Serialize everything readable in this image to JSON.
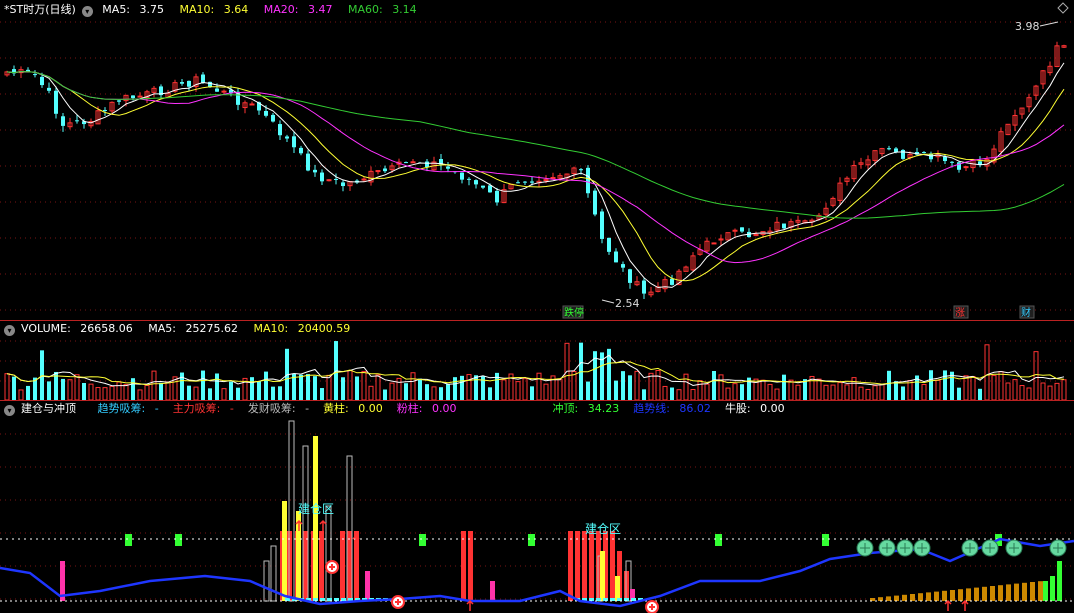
{
  "colors": {
    "ma5": "#ffffff",
    "ma10": "#ffff33",
    "ma20": "#ff33ff",
    "ma60": "#33cc33",
    "up": "#ff3333",
    "down": "#54ffff",
    "volume_up": "#ff3333",
    "volume_down": "#54ffff",
    "trend_line": "#1e36ff",
    "grid": "#7a1515"
  },
  "price_panel": {
    "title": "*ST时万(日线)",
    "ma5_label": "MA5:",
    "ma5_value": "3.75",
    "ma10_label": "MA10:",
    "ma10_value": "3.64",
    "ma20_label": "MA20:",
    "ma20_value": "3.47",
    "ma60_label": "MA60:",
    "ma60_value": "3.14",
    "high_label": "3.98",
    "low_label": "2.54",
    "event_tags": [
      "跌停",
      "涨",
      "财"
    ]
  },
  "volume_panel": {
    "title": "VOLUME:",
    "volume_value": "26658.06",
    "ma5_label": "MA5:",
    "ma5_value": "25275.62",
    "ma10_label": "MA10:",
    "ma10_value": "20400.59"
  },
  "indicator_panel": {
    "title": "建仓与冲顶",
    "items": [
      {
        "label": "趋势吸筹:",
        "value": "-",
        "color": "#33ccff"
      },
      {
        "label": "主力吸筹:",
        "value": "-",
        "color": "#ff3333"
      },
      {
        "label": "发财吸筹:",
        "value": "-",
        "color": "#bbbbbb"
      },
      {
        "label": "黄柱:",
        "value": "0.00",
        "color": "#ffff33"
      },
      {
        "label": "粉柱:",
        "value": "0.00",
        "color": "#ff33ff"
      },
      {
        "label": "冲顶:",
        "value": "34.23",
        "color": "#33ff33"
      },
      {
        "label": "趋势线:",
        "value": "86.02",
        "color": "#1e36ff"
      },
      {
        "label": "牛股:",
        "value": "0.00",
        "color": "#ffffff"
      }
    ],
    "zone_labels": [
      "建仓区",
      "建仓区"
    ]
  }
}
